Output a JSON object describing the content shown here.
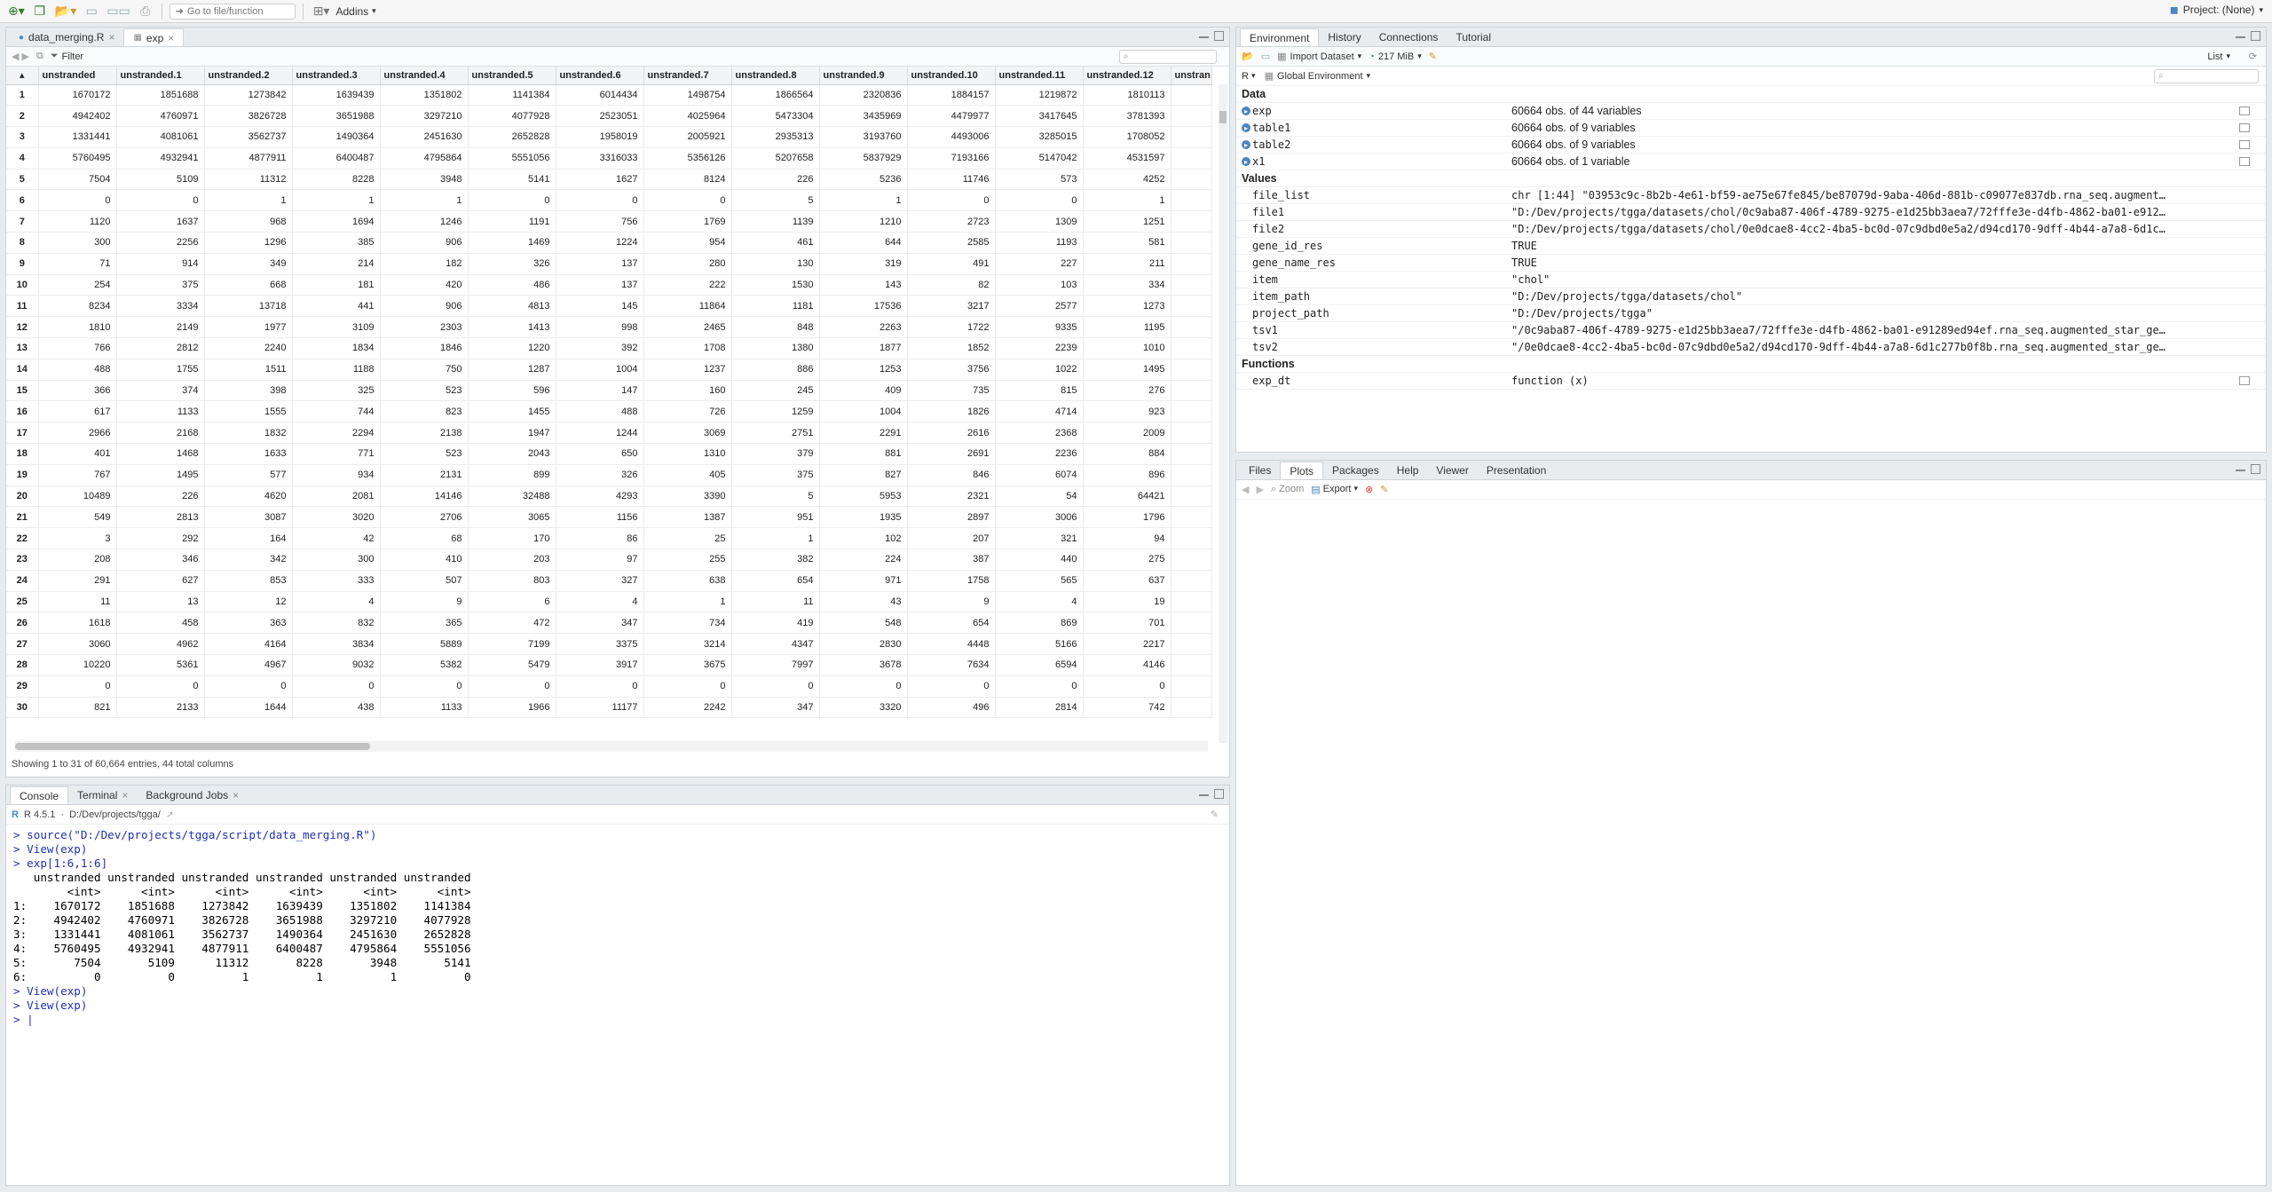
{
  "topbar": {
    "goto_placeholder": "Go to file/function",
    "addins_label": "Addins",
    "project_label": "Project: (None)"
  },
  "editor": {
    "tabs": [
      {
        "label": "data_merging.R"
      },
      {
        "label": "exp"
      }
    ],
    "filter_label": "Filter",
    "columns": [
      "unstranded",
      "unstranded.1",
      "unstranded.2",
      "unstranded.3",
      "unstranded.4",
      "unstranded.5",
      "unstranded.6",
      "unstranded.7",
      "unstranded.8",
      "unstranded.9",
      "unstranded.10",
      "unstranded.11",
      "unstranded.12",
      "unstran"
    ],
    "rows": [
      [
        "1",
        "1670172",
        "1851688",
        "1273842",
        "1639439",
        "1351802",
        "1141384",
        "6014434",
        "1498754",
        "1866564",
        "2320836",
        "1884157",
        "1219872",
        "1810113",
        ""
      ],
      [
        "2",
        "4942402",
        "4760971",
        "3826728",
        "3651988",
        "3297210",
        "4077928",
        "2523051",
        "4025964",
        "5473304",
        "3435969",
        "4479977",
        "3417645",
        "3781393",
        ""
      ],
      [
        "3",
        "1331441",
        "4081061",
        "3562737",
        "1490364",
        "2451630",
        "2652828",
        "1958019",
        "2005921",
        "2935313",
        "3193760",
        "4493006",
        "3285015",
        "1708052",
        ""
      ],
      [
        "4",
        "5760495",
        "4932941",
        "4877911",
        "6400487",
        "4795864",
        "5551056",
        "3316033",
        "5356126",
        "5207658",
        "5837929",
        "7193166",
        "5147042",
        "4531597",
        ""
      ],
      [
        "5",
        "7504",
        "5109",
        "11312",
        "8228",
        "3948",
        "5141",
        "1627",
        "8124",
        "226",
        "5236",
        "11746",
        "573",
        "4252",
        ""
      ],
      [
        "6",
        "0",
        "0",
        "1",
        "1",
        "1",
        "0",
        "0",
        "0",
        "5",
        "1",
        "0",
        "0",
        "1",
        ""
      ],
      [
        "7",
        "1120",
        "1637",
        "968",
        "1694",
        "1246",
        "1191",
        "756",
        "1769",
        "1139",
        "1210",
        "2723",
        "1309",
        "1251",
        ""
      ],
      [
        "8",
        "300",
        "2256",
        "1296",
        "385",
        "906",
        "1469",
        "1224",
        "954",
        "461",
        "644",
        "2585",
        "1193",
        "581",
        ""
      ],
      [
        "9",
        "71",
        "914",
        "349",
        "214",
        "182",
        "326",
        "137",
        "280",
        "130",
        "319",
        "491",
        "227",
        "211",
        ""
      ],
      [
        "10",
        "254",
        "375",
        "668",
        "181",
        "420",
        "486",
        "137",
        "222",
        "1530",
        "143",
        "82",
        "103",
        "334",
        ""
      ],
      [
        "11",
        "8234",
        "3334",
        "13718",
        "441",
        "906",
        "4813",
        "145",
        "11864",
        "1181",
        "17536",
        "3217",
        "2577",
        "1273",
        ""
      ],
      [
        "12",
        "1810",
        "2149",
        "1977",
        "3109",
        "2303",
        "1413",
        "998",
        "2465",
        "848",
        "2263",
        "1722",
        "9335",
        "1195",
        ""
      ],
      [
        "13",
        "766",
        "2812",
        "2240",
        "1834",
        "1846",
        "1220",
        "392",
        "1708",
        "1380",
        "1877",
        "1852",
        "2239",
        "1010",
        ""
      ],
      [
        "14",
        "488",
        "1755",
        "1511",
        "1188",
        "750",
        "1287",
        "1004",
        "1237",
        "886",
        "1253",
        "3756",
        "1022",
        "1495",
        ""
      ],
      [
        "15",
        "366",
        "374",
        "398",
        "325",
        "523",
        "596",
        "147",
        "160",
        "245",
        "409",
        "735",
        "815",
        "276",
        ""
      ],
      [
        "16",
        "617",
        "1133",
        "1555",
        "744",
        "823",
        "1455",
        "488",
        "726",
        "1259",
        "1004",
        "1826",
        "4714",
        "923",
        ""
      ],
      [
        "17",
        "2966",
        "2168",
        "1832",
        "2294",
        "2138",
        "1947",
        "1244",
        "3069",
        "2751",
        "2291",
        "2616",
        "2368",
        "2009",
        ""
      ],
      [
        "18",
        "401",
        "1468",
        "1633",
        "771",
        "523",
        "2043",
        "650",
        "1310",
        "379",
        "881",
        "2691",
        "2236",
        "884",
        ""
      ],
      [
        "19",
        "767",
        "1495",
        "577",
        "934",
        "2131",
        "899",
        "326",
        "405",
        "375",
        "827",
        "846",
        "6074",
        "896",
        ""
      ],
      [
        "20",
        "10489",
        "226",
        "4620",
        "2081",
        "14146",
        "32488",
        "4293",
        "3390",
        "5",
        "5953",
        "2321",
        "54",
        "64421",
        ""
      ],
      [
        "21",
        "549",
        "2813",
        "3087",
        "3020",
        "2706",
        "3065",
        "1156",
        "1387",
        "951",
        "1935",
        "2897",
        "3006",
        "1796",
        ""
      ],
      [
        "22",
        "3",
        "292",
        "164",
        "42",
        "68",
        "170",
        "86",
        "25",
        "1",
        "102",
        "207",
        "321",
        "94",
        ""
      ],
      [
        "23",
        "208",
        "346",
        "342",
        "300",
        "410",
        "203",
        "97",
        "255",
        "382",
        "224",
        "387",
        "440",
        "275",
        ""
      ],
      [
        "24",
        "291",
        "627",
        "853",
        "333",
        "507",
        "803",
        "327",
        "638",
        "654",
        "971",
        "1758",
        "565",
        "637",
        ""
      ],
      [
        "25",
        "11",
        "13",
        "12",
        "4",
        "9",
        "6",
        "4",
        "1",
        "11",
        "43",
        "9",
        "4",
        "19",
        ""
      ],
      [
        "26",
        "1618",
        "458",
        "363",
        "832",
        "365",
        "472",
        "347",
        "734",
        "419",
        "548",
        "654",
        "869",
        "701",
        ""
      ],
      [
        "27",
        "3060",
        "4962",
        "4164",
        "3834",
        "5889",
        "7199",
        "3375",
        "3214",
        "4347",
        "2830",
        "4448",
        "5166",
        "2217",
        ""
      ],
      [
        "28",
        "10220",
        "5361",
        "4967",
        "9032",
        "5382",
        "5479",
        "3917",
        "3675",
        "7997",
        "3678",
        "7634",
        "6594",
        "4146",
        ""
      ],
      [
        "29",
        "0",
        "0",
        "0",
        "0",
        "0",
        "0",
        "0",
        "0",
        "0",
        "0",
        "0",
        "0",
        "0",
        ""
      ],
      [
        "30",
        "821",
        "2133",
        "1644",
        "438",
        "1133",
        "1966",
        "11177",
        "2242",
        "347",
        "3320",
        "496",
        "2814",
        "742",
        ""
      ]
    ],
    "status": "Showing 1 to 31 of 60,664 entries, 44 total columns"
  },
  "console": {
    "tabs": [
      {
        "label": "Console"
      },
      {
        "label": "Terminal"
      },
      {
        "label": "Background Jobs"
      }
    ],
    "r_version": "R 4.5.1",
    "wd": "D:/Dev/projects/tgga/",
    "lines": [
      {
        "type": "cmd",
        "text": "> source(\"D:/Dev/projects/tgga/script/data_merging.R\")"
      },
      {
        "type": "cmd",
        "text": "> View(exp)"
      },
      {
        "type": "cmd",
        "text": "> exp[1:6,1:6]"
      },
      {
        "type": "out",
        "text": "   unstranded unstranded unstranded unstranded unstranded unstranded"
      },
      {
        "type": "out",
        "text": "        <int>      <int>      <int>      <int>      <int>      <int>"
      },
      {
        "type": "out",
        "text": "1:    1670172    1851688    1273842    1639439    1351802    1141384"
      },
      {
        "type": "out",
        "text": "2:    4942402    4760971    3826728    3651988    3297210    4077928"
      },
      {
        "type": "out",
        "text": "3:    1331441    4081061    3562737    1490364    2451630    2652828"
      },
      {
        "type": "out",
        "text": "4:    5760495    4932941    4877911    6400487    4795864    5551056"
      },
      {
        "type": "out",
        "text": "5:       7504       5109      11312       8228       3948       5141"
      },
      {
        "type": "out",
        "text": "6:          0          0          1          1          1          0"
      },
      {
        "type": "cmd",
        "text": "> View(exp)"
      },
      {
        "type": "cmd",
        "text": "> View(exp)"
      },
      {
        "type": "cmd",
        "text": "> |"
      }
    ]
  },
  "environment": {
    "tabs": [
      {
        "label": "Environment"
      },
      {
        "label": "History"
      },
      {
        "label": "Connections"
      },
      {
        "label": "Tutorial"
      }
    ],
    "import_label": "Import Dataset",
    "memory_label": "217 MiB",
    "list_label": "List",
    "lang_label": "R",
    "scope_label": "Global Environment",
    "sections": [
      {
        "title": "Data",
        "rows": [
          {
            "name": "exp",
            "value": "60664 obs. of 44 variables",
            "expand": true
          },
          {
            "name": "table1",
            "value": "60664 obs. of 9 variables",
            "expand": true
          },
          {
            "name": "table2",
            "value": "60664 obs. of 9 variables",
            "expand": true
          },
          {
            "name": "x1",
            "value": "60664 obs. of 1 variable",
            "expand": true
          }
        ]
      },
      {
        "title": "Values",
        "rows": [
          {
            "name": "file_list",
            "value": "chr [1:44] \"03953c9c-8b2b-4e61-bf59-ae75e67fe845/be87079d-9aba-406d-881b-c09077e837db.rna_seq.augment…"
          },
          {
            "name": "file1",
            "value": "\"D:/Dev/projects/tgga/datasets/chol/0c9aba87-406f-4789-9275-e1d25bb3aea7/72fffe3e-d4fb-4862-ba01-e912…"
          },
          {
            "name": "file2",
            "value": "\"D:/Dev/projects/tgga/datasets/chol/0e0dcae8-4cc2-4ba5-bc0d-07c9dbd0e5a2/d94cd170-9dff-4b44-a7a8-6d1c…"
          },
          {
            "name": "gene_id_res",
            "value": "TRUE"
          },
          {
            "name": "gene_name_res",
            "value": "TRUE"
          },
          {
            "name": "item",
            "value": "\"chol\""
          },
          {
            "name": "item_path",
            "value": "\"D:/Dev/projects/tgga/datasets/chol\""
          },
          {
            "name": "project_path",
            "value": "\"D:/Dev/projects/tgga\""
          },
          {
            "name": "tsv1",
            "value": "\"/0c9aba87-406f-4789-9275-e1d25bb3aea7/72fffe3e-d4fb-4862-ba01-e91289ed94ef.rna_seq.augmented_star_ge…"
          },
          {
            "name": "tsv2",
            "value": "\"/0e0dcae8-4cc2-4ba5-bc0d-07c9dbd0e5a2/d94cd170-9dff-4b44-a7a8-6d1c277b0f8b.rna_seq.augmented_star_ge…"
          }
        ]
      },
      {
        "title": "Functions",
        "rows": [
          {
            "name": "exp_dt",
            "value": "function (x)"
          }
        ]
      }
    ]
  },
  "files": {
    "tabs": [
      {
        "label": "Files"
      },
      {
        "label": "Plots"
      },
      {
        "label": "Packages"
      },
      {
        "label": "Help"
      },
      {
        "label": "Viewer"
      },
      {
        "label": "Presentation"
      }
    ],
    "zoom_label": "Zoom",
    "export_label": "Export"
  }
}
